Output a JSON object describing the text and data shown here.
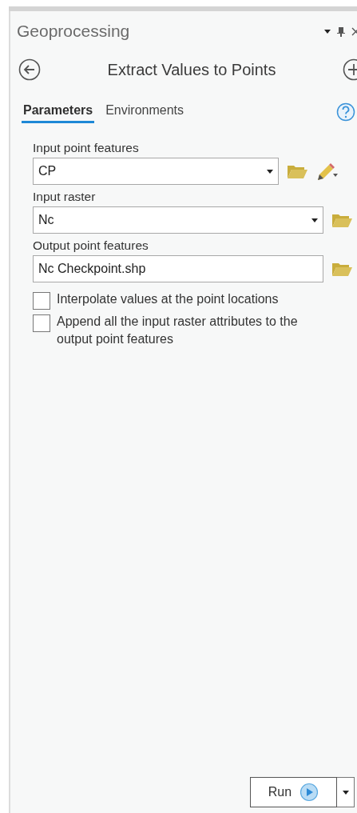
{
  "panel": {
    "title": "Geoprocessing"
  },
  "tool": {
    "title": "Extract Values to Points"
  },
  "tabs": [
    {
      "label": "Parameters",
      "selected": true
    },
    {
      "label": "Environments",
      "selected": false
    }
  ],
  "parameters": [
    {
      "kind": "layer",
      "label": "Input point features",
      "value": "CP"
    },
    {
      "kind": "dropdown",
      "label": "Input raster",
      "value": "Nc"
    },
    {
      "kind": "text",
      "label": "Output point features",
      "value": "Nc Checkpoint.shp"
    }
  ],
  "options": [
    {
      "label": "Interpolate values at the point locations",
      "checked": false
    },
    {
      "label": "Append all the input raster attributes to the output point features",
      "checked": false
    }
  ],
  "run_button": {
    "label": "Run"
  }
}
